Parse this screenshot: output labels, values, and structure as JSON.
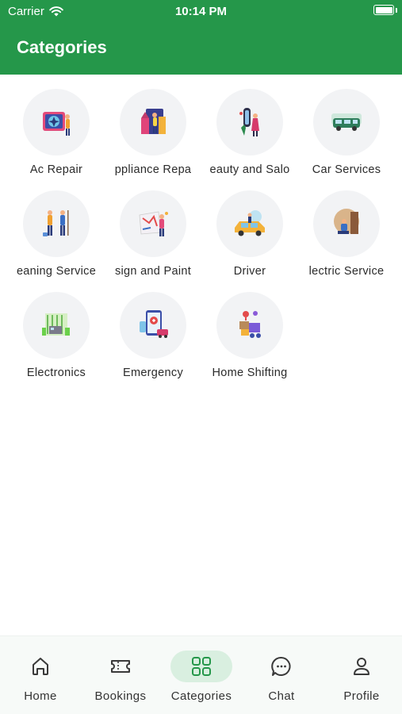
{
  "status_bar": {
    "carrier": "Carrier",
    "time": "10:14 PM",
    "battery_level": 1.0
  },
  "header": {
    "title": "Categories"
  },
  "colors": {
    "primary": "#25974a",
    "active_tab_bg": "#d9efe0",
    "circle_bg": "#f2f3f5"
  },
  "categories": [
    {
      "label": "Ac Repair",
      "icon": "ac-repair-icon"
    },
    {
      "label": "ppliance Repa",
      "icon": "appliance-repair-icon"
    },
    {
      "label": "eauty and Salo",
      "icon": "beauty-salon-icon"
    },
    {
      "label": "Car Services",
      "icon": "car-services-icon"
    },
    {
      "label": "eaning Service",
      "icon": "cleaning-service-icon"
    },
    {
      "label": "sign and Paint",
      "icon": "design-paint-icon"
    },
    {
      "label": "Driver",
      "icon": "driver-icon"
    },
    {
      "label": "lectric Service",
      "icon": "electric-service-icon"
    },
    {
      "label": "Electronics",
      "icon": "electronics-icon"
    },
    {
      "label": "Emergency",
      "icon": "emergency-icon"
    },
    {
      "label": "Home Shifting",
      "icon": "home-shifting-icon"
    }
  ],
  "bottom_nav": {
    "active": "Categories",
    "items": [
      {
        "label": "Home",
        "icon": "home-icon"
      },
      {
        "label": "Bookings",
        "icon": "ticket-icon"
      },
      {
        "label": "Categories",
        "icon": "grid-icon"
      },
      {
        "label": "Chat",
        "icon": "chat-icon"
      },
      {
        "label": "Profile",
        "icon": "profile-icon"
      }
    ]
  }
}
